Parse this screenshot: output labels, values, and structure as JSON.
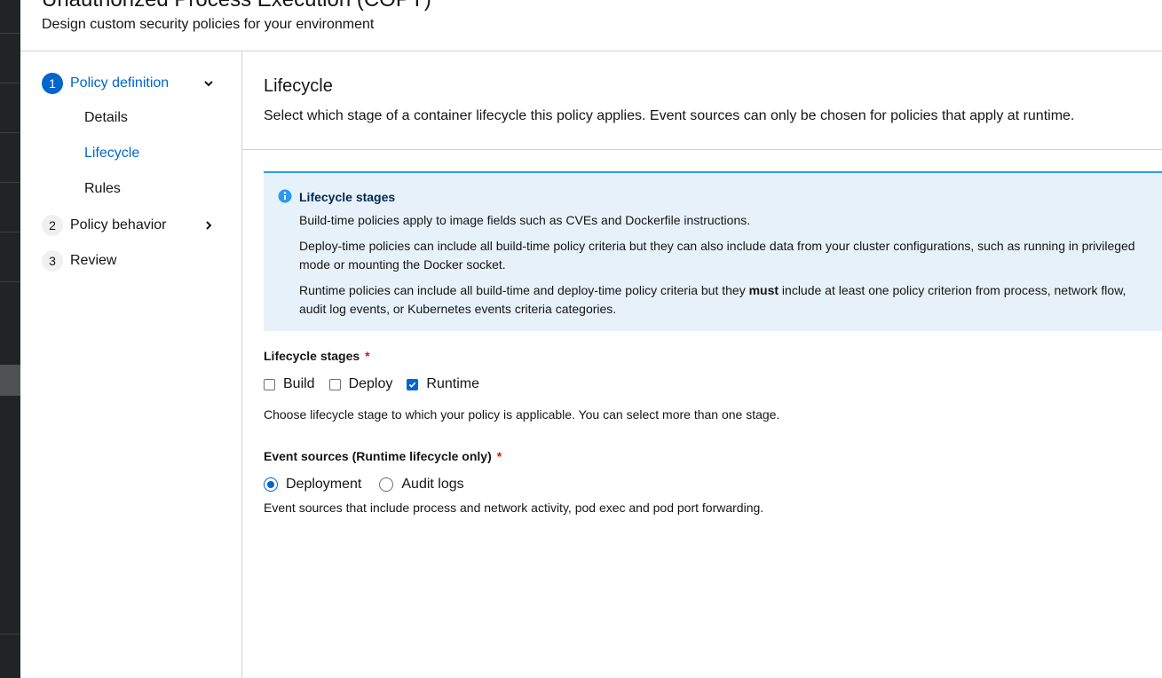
{
  "header": {
    "title": "Unauthorized Process Execution (COPY)",
    "subtitle": "Design custom security policies for your environment"
  },
  "wizard": {
    "steps": [
      {
        "number": "1",
        "label": "Policy definition",
        "substeps": [
          "Details",
          "Lifecycle",
          "Rules"
        ]
      },
      {
        "number": "2",
        "label": "Policy behavior"
      },
      {
        "number": "3",
        "label": "Review"
      }
    ]
  },
  "main": {
    "title": "Lifecycle",
    "description": "Select which stage of a container lifecycle this policy applies. Event sources can only be chosen for policies that apply at runtime.",
    "alert": {
      "title": "Lifecycle stages",
      "line1": "Build-time policies apply to image fields such as CVEs and Dockerfile instructions.",
      "line2": "Deploy-time policies can include all build-time policy criteria but they can also include data from your cluster configurations, such as running in privileged mode or mounting the Docker socket.",
      "line3_pre": "Runtime policies can include all build-time and deploy-time policy criteria but they ",
      "line3_bold": "must",
      "line3_post": " include at least one policy criterion from process, network flow, audit log events, or Kubernetes events criteria categories."
    },
    "lifecycle_stages": {
      "label": "Lifecycle stages",
      "required_mark": "*",
      "options": [
        {
          "label": "Build",
          "checked": false
        },
        {
          "label": "Deploy",
          "checked": false
        },
        {
          "label": "Runtime",
          "checked": true
        }
      ],
      "helper": "Choose lifecycle stage to which your policy is applicable. You can select more than one stage."
    },
    "event_sources": {
      "label": "Event sources (Runtime lifecycle only)",
      "required_mark": "*",
      "options": [
        {
          "label": "Deployment",
          "selected": true
        },
        {
          "label": "Audit logs",
          "selected": false
        }
      ],
      "helper": "Event sources that include process and network activity, pod exec and pod port forwarding."
    }
  },
  "colors": {
    "accent": "#0066cc",
    "alert_bg": "#e7f1fa",
    "alert_border": "#2b9af3",
    "required": "#c9190b",
    "nav_bg": "#212427"
  }
}
